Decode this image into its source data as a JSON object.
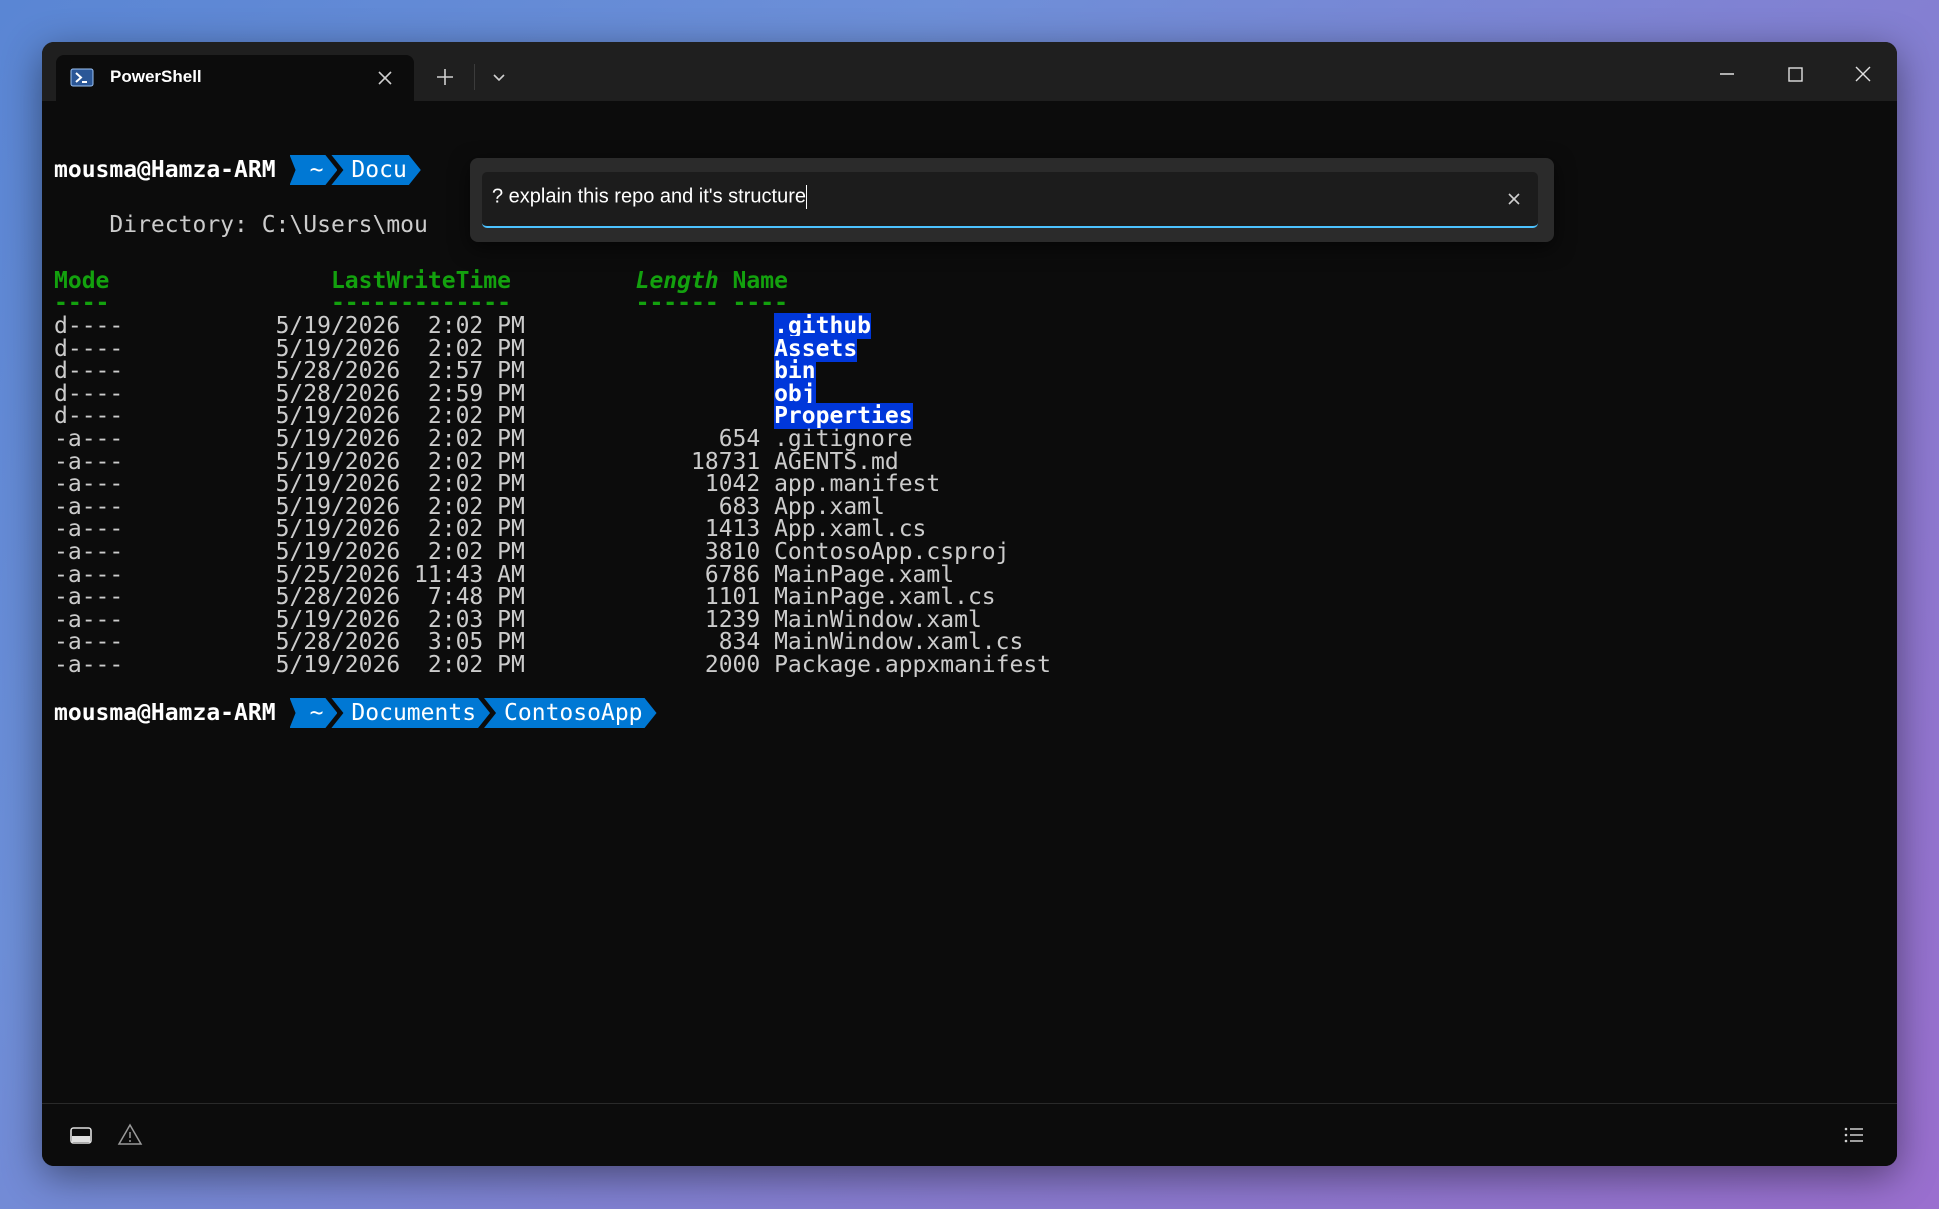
{
  "tab": {
    "title": "PowerShell"
  },
  "icons": {
    "tab": "powershell-icon",
    "close": "close-icon",
    "add": "plus-icon",
    "dropdown": "chevron-down-icon",
    "minimize": "minimize-icon",
    "maximize": "maximize-icon",
    "window_close": "close-icon",
    "panel": "panel-icon",
    "warning": "warning-icon",
    "menu": "list-icon"
  },
  "colors": {
    "accent": "#4cc2ff",
    "prompt_segment": "#0078d4",
    "header_green": "#13a10e",
    "dir_highlight": "#0037da"
  },
  "prompt1": {
    "user": "mousma@Hamza-ARM",
    "seg_home": "~",
    "seg_partial": "Docu"
  },
  "directory_line": "    Directory: C:\\Users\\mou",
  "headers": {
    "mode": "Mode",
    "lastwritetime": "LastWriteTime",
    "length": "Length",
    "name": "Name"
  },
  "header_underlines": {
    "mode": "----",
    "lastwritetime": "-------------",
    "length": "------",
    "name": "----"
  },
  "rows": [
    {
      "mode": "d----",
      "date": "5/19/2026",
      "time": " 2:02 PM",
      "length": "",
      "name": ".github"
    },
    {
      "mode": "d----",
      "date": "5/19/2026",
      "time": " 2:02 PM",
      "length": "",
      "name": "Assets"
    },
    {
      "mode": "d----",
      "date": "5/28/2026",
      "time": " 2:57 PM",
      "length": "",
      "name": "bin"
    },
    {
      "mode": "d----",
      "date": "5/28/2026",
      "time": " 2:59 PM",
      "length": "",
      "name": "obj"
    },
    {
      "mode": "d----",
      "date": "5/19/2026",
      "time": " 2:02 PM",
      "length": "",
      "name": "Properties"
    },
    {
      "mode": "-a---",
      "date": "5/19/2026",
      "time": " 2:02 PM",
      "length": "654",
      "name": ".gitignore"
    },
    {
      "mode": "-a---",
      "date": "5/19/2026",
      "time": " 2:02 PM",
      "length": "18731",
      "name": "AGENTS.md"
    },
    {
      "mode": "-a---",
      "date": "5/19/2026",
      "time": " 2:02 PM",
      "length": "1042",
      "name": "app.manifest"
    },
    {
      "mode": "-a---",
      "date": "5/19/2026",
      "time": " 2:02 PM",
      "length": "683",
      "name": "App.xaml"
    },
    {
      "mode": "-a---",
      "date": "5/19/2026",
      "time": " 2:02 PM",
      "length": "1413",
      "name": "App.xaml.cs"
    },
    {
      "mode": "-a---",
      "date": "5/19/2026",
      "time": " 2:02 PM",
      "length": "3810",
      "name": "ContosoApp.csproj"
    },
    {
      "mode": "-a---",
      "date": "5/25/2026",
      "time": "11:43 AM",
      "length": "6786",
      "name": "MainPage.xaml"
    },
    {
      "mode": "-a---",
      "date": "5/28/2026",
      "time": " 7:48 PM",
      "length": "1101",
      "name": "MainPage.xaml.cs"
    },
    {
      "mode": "-a---",
      "date": "5/19/2026",
      "time": " 2:03 PM",
      "length": "1239",
      "name": "MainWindow.xaml"
    },
    {
      "mode": "-a---",
      "date": "5/28/2026",
      "time": " 3:05 PM",
      "length": "834",
      "name": "MainWindow.xaml.cs"
    },
    {
      "mode": "-a---",
      "date": "5/19/2026",
      "time": " 2:02 PM",
      "length": "2000",
      "name": "Package.appxmanifest"
    }
  ],
  "prompt2": {
    "user": "mousma@Hamza-ARM",
    "segments": [
      "~",
      "Documents",
      "ContosoApp"
    ]
  },
  "search": {
    "value": "? explain this repo and it's structure"
  }
}
